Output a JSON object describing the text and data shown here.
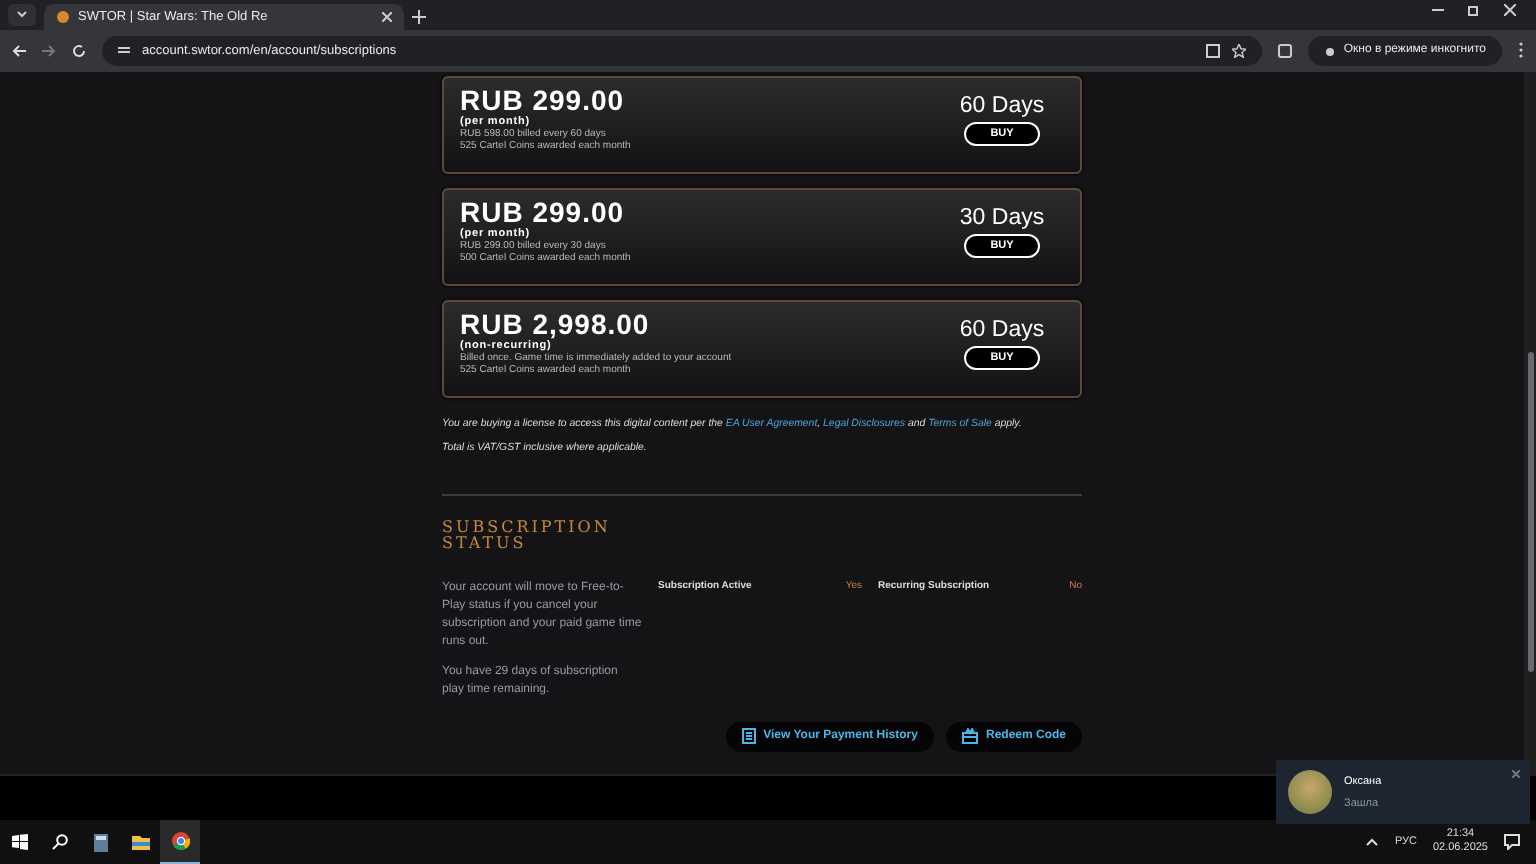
{
  "browser": {
    "tab_title": "SWTOR | Star Wars: The Old Re",
    "url": "account.swtor.com/en/account/subscriptions",
    "incognito_label": "Окно в режиме инкогнито"
  },
  "plans": [
    {
      "price": "RUB 299.00",
      "period": "(per month)",
      "details": [
        "RUB 598.00 billed every 60 days",
        "525 Cartel Coins awarded each month"
      ],
      "duration": "60 Days",
      "button": "BUY"
    },
    {
      "price": "RUB 299.00",
      "period": "(per month)",
      "details": [
        "RUB 299.00 billed every 30 days",
        "500 Cartel Coins awarded each month"
      ],
      "duration": "30 Days",
      "button": "BUY"
    },
    {
      "price": "RUB 2,998.00",
      "period": "(non-recurring)",
      "details": [
        "Billed once. Game time is immediately added to your account",
        "525 Cartel Coins awarded each month"
      ],
      "duration": "60 Days",
      "button": "BUY"
    }
  ],
  "legal": [
    {
      "kind": "text",
      "text": "You are buying a license to access this digital content per the"
    },
    {
      "kind": "link",
      "text": "EA User Agreement"
    },
    {
      "kind": "text",
      "text": ","
    },
    {
      "kind": "link",
      "text": "Legal Disclosures"
    },
    {
      "kind": "text",
      "text": "and"
    },
    {
      "kind": "link",
      "text": "Terms of Sale"
    },
    {
      "kind": "text",
      "text": "apply."
    }
  ],
  "vat_note": "Total is VAT/GST inclusive where applicable.",
  "subscription_status": {
    "heading": [
      "SUBSCRIPTION",
      "STATUS"
    ],
    "info": [
      "Your account will move to Free-to-Play status if you cancel your subscription and your paid game time runs out.",
      "You have 29 days of subscription play time remaining."
    ],
    "fields": [
      {
        "label": "Subscription Active",
        "value": "Yes"
      },
      {
        "label": "Recurring Subscription",
        "value": "No"
      }
    ],
    "buttons": [
      {
        "kind": "history",
        "label": "View Your Payment History"
      },
      {
        "kind": "redeem",
        "label": "Redeem Code"
      }
    ]
  },
  "notification": {
    "name": "Оксана",
    "message": "Зашла"
  },
  "taskbar": {
    "language": "РУС",
    "time": "21:34",
    "date": "02.06.2025"
  }
}
